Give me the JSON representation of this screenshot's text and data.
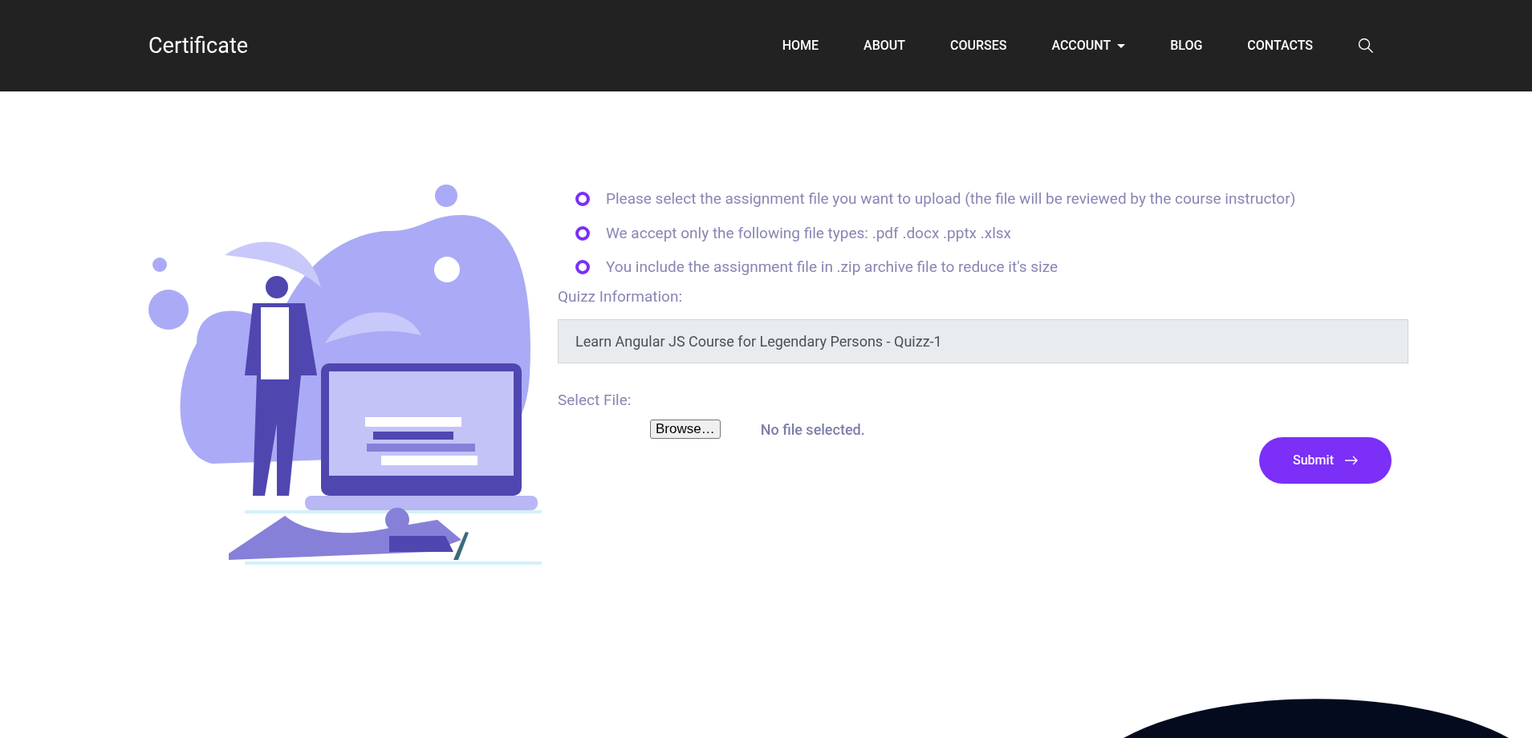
{
  "navbar": {
    "brand": "Certificate",
    "items": [
      {
        "label": "HOME",
        "has_dropdown": false
      },
      {
        "label": "ABOUT",
        "has_dropdown": false
      },
      {
        "label": "COURSES",
        "has_dropdown": false
      },
      {
        "label": "ACCOUNT",
        "has_dropdown": true
      },
      {
        "label": "BLOG",
        "has_dropdown": false
      },
      {
        "label": "CONTACTS",
        "has_dropdown": false
      }
    ]
  },
  "notes": [
    "Please select the assignment file you want to upload (the file will be reviewed by the course instructor)",
    "We accept only the following file types: .pdf .docx .pptx .xlsx",
    "You include the assignment file in .zip archive file to reduce it's size"
  ],
  "quiz": {
    "label": "Quizz Information:",
    "value": "Learn Angular JS Course for Legendary Persons - Quizz-1"
  },
  "file": {
    "label": "Select File:",
    "button": "Browse…",
    "status": "No file selected."
  },
  "submit": {
    "label": "Submit"
  }
}
